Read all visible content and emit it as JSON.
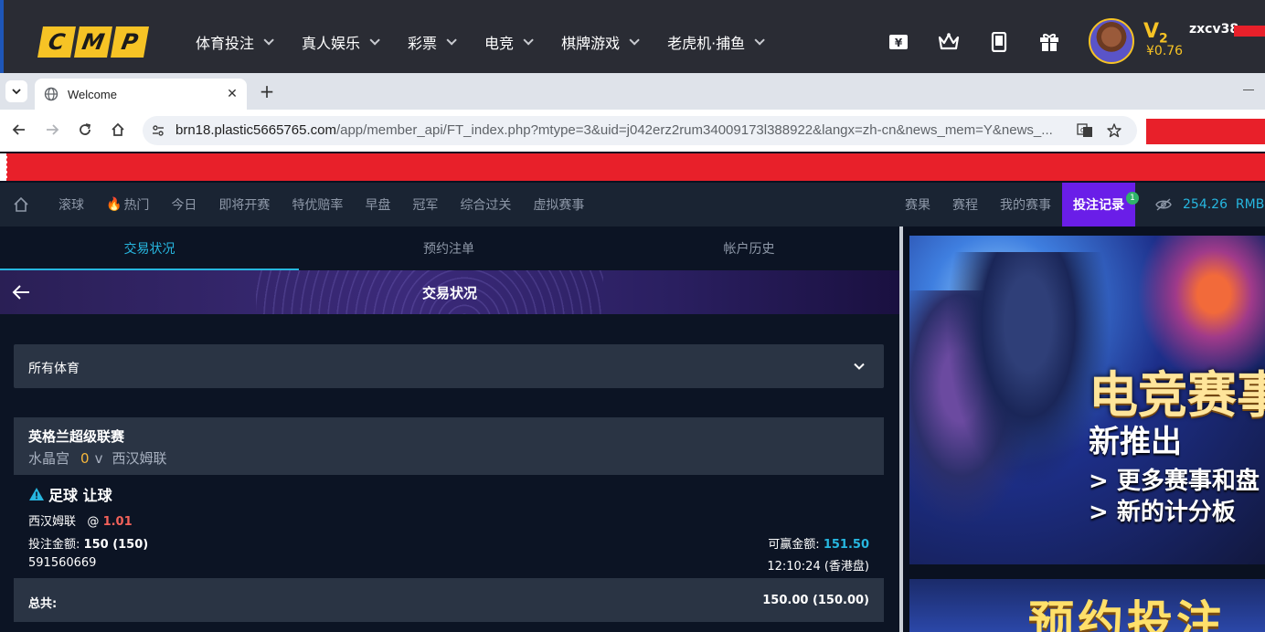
{
  "site": {
    "logo_letters": [
      "C",
      "M",
      "P"
    ],
    "nav": [
      {
        "label": "体育投注"
      },
      {
        "label": "真人娱乐"
      },
      {
        "label": "彩票"
      },
      {
        "label": "电竞"
      },
      {
        "label": "棋牌游戏"
      },
      {
        "label": "老虎机·捕鱼"
      }
    ],
    "header_icons": [
      "wallet-icon",
      "crown-icon",
      "tablet-icon",
      "gift-icon"
    ],
    "vip_level": "V",
    "vip_number": "2",
    "balance": "¥0.76",
    "username": "zxcv38"
  },
  "browser": {
    "tab_title": "Welcome",
    "url_host": "brn18.plastic5665765.com",
    "url_path": "/app/member_api/FT_index.php?mtype=3&uid=j042erz2rum34009173l388922&langx=zh-cn&news_mem=Y&news_..."
  },
  "sportsbar": {
    "left": [
      "滚球",
      "热门",
      "今日",
      "即将开赛",
      "特优赔率",
      "早盘",
      "冠军",
      "综合过关",
      "虚拟赛事"
    ],
    "right": [
      "赛果",
      "赛程",
      "我的赛事"
    ],
    "bet_record": "投注记录",
    "bet_badge": "1",
    "balance": "254.26",
    "currency": "RMB"
  },
  "subtabs": [
    "交易状况",
    "预约注单",
    "帐户历史"
  ],
  "page_title": "交易状况",
  "sport_filter": "所有体育",
  "bet": {
    "league": "英格兰超级联赛",
    "home": "水晶宫",
    "score": "0",
    "vs": "v",
    "away": "西汉姆联",
    "type": "足球 让球",
    "pick": "西汉姆联",
    "odds_prefix": "@",
    "odds": "1.01",
    "stake_label": "投注金额:",
    "stake_value": "150 (150)",
    "win_label": "可赢金额:",
    "win_value": "151.50",
    "ticket_id": "591560669",
    "time": "12:10:24 (香港盘)"
  },
  "total": {
    "label": "总共:",
    "value": "150.00 (150.00)"
  },
  "banners": {
    "esports_title": "电竞赛事",
    "esports_sub": "新推出",
    "esports_line1": "> 更多赛事和盘",
    "esports_line2": "> 新的计分板",
    "reserve_title": "预约投注"
  },
  "colors": {
    "accent": "#27b7e0",
    "brand_yellow": "#f6c325",
    "bet_record_bg": "#6a1ee8",
    "redaction": "#e8202a"
  }
}
